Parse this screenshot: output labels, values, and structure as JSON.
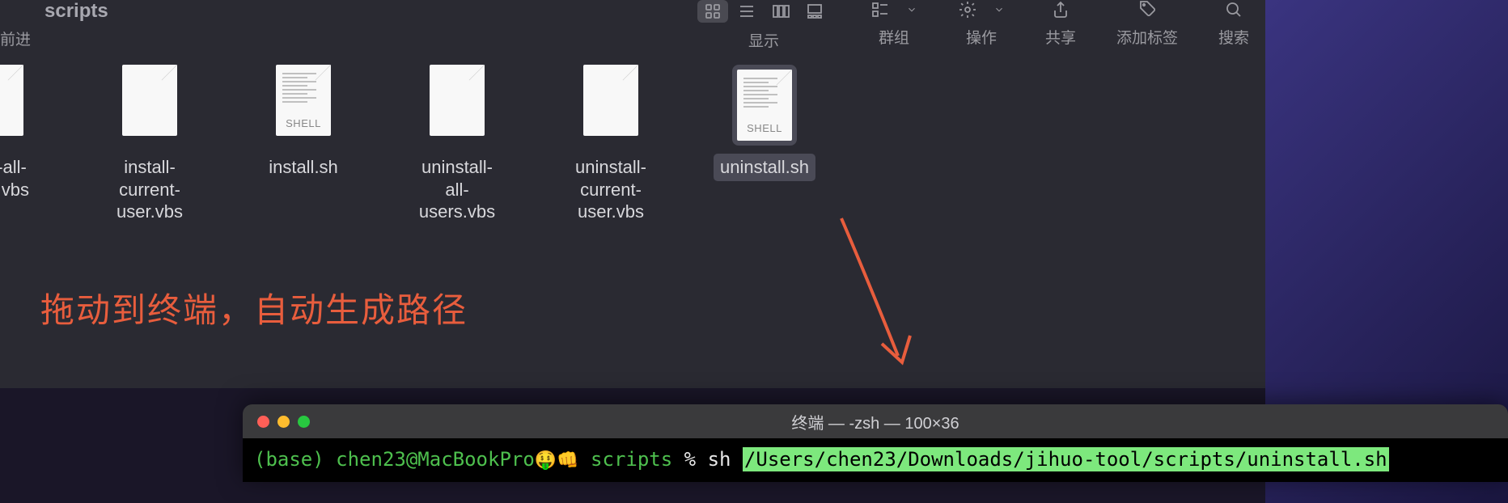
{
  "finder": {
    "folder_title": "scripts",
    "nav_forward_label": "前进",
    "toolbar": {
      "view_label": "显示",
      "group_label": "群组",
      "action_label": "操作",
      "share_label": "共享",
      "tags_label": "添加标签",
      "search_label": "搜索"
    },
    "files": [
      {
        "name": "stall-all-\nsers.vbs",
        "type": "plain",
        "selected": false
      },
      {
        "name": "install-current-\nuser.vbs",
        "type": "plain",
        "selected": false
      },
      {
        "name": "install.sh",
        "type": "shell",
        "selected": false
      },
      {
        "name": "uninstall-all-\nusers.vbs",
        "type": "plain",
        "selected": false
      },
      {
        "name": "uninstall-current-\nuser.vbs",
        "type": "plain",
        "selected": false
      },
      {
        "name": "uninstall.sh",
        "type": "shell",
        "selected": true
      }
    ],
    "shell_badge": "SHELL"
  },
  "annotation": {
    "text": "拖动到终端，自动生成路径"
  },
  "terminal": {
    "title": "终端 — -zsh — 100×36",
    "prompt_base": "(base)",
    "prompt_user": "chen23@MacBookPro",
    "prompt_emoji": "🤑👊",
    "prompt_folder": "scripts",
    "prompt_symbol": "%",
    "command": "sh",
    "path_highlight": "/Users/chen23/Downloads/jihuo-tool/scripts/uninstall.sh"
  }
}
